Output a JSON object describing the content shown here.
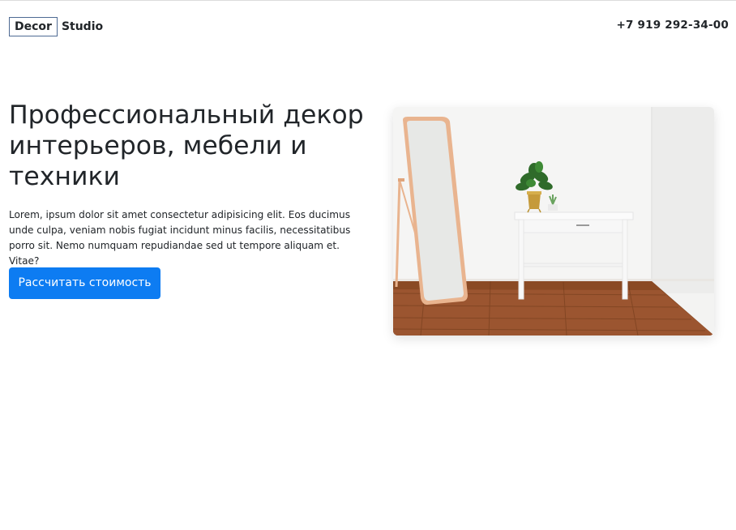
{
  "header": {
    "logo_box": "Decor",
    "logo_text": "Studio",
    "phone": "+7 919 292-34-00"
  },
  "hero": {
    "title": "Профессиональный декор интерьеров, мебели и техники",
    "text": "Lorem, ipsum dolor sit amet consectetur adipisicing elit. Eos ducimus unde culpa, veniam nobis fugiat incidunt minus facilis, necessitatibus porro sit. Nemo numquam repudiandae sed ut tempore aliquam et. Vitae?",
    "button_label": "Рассчитать стоимость"
  },
  "colors": {
    "accent": "#0d7cf2",
    "logo_border": "#4e6a93",
    "text": "#212529"
  },
  "icons": {
    "photo": "interior-photo-mirror-table-plant"
  }
}
